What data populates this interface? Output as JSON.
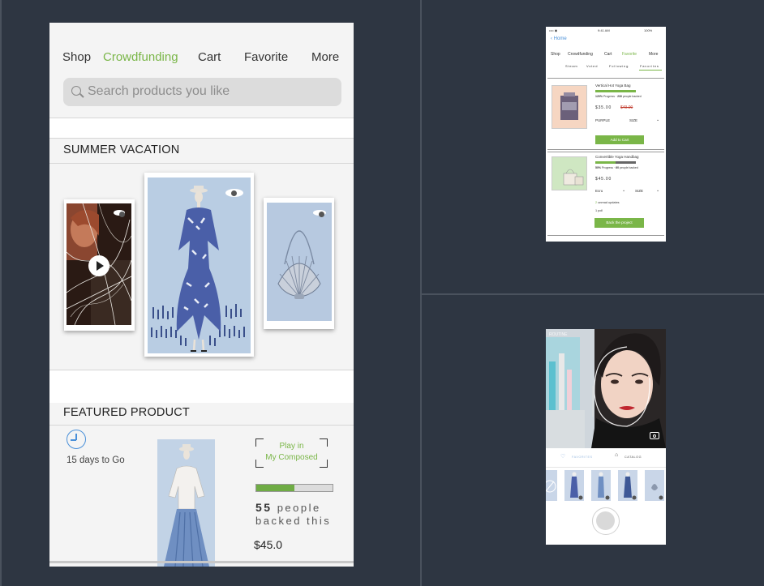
{
  "main": {
    "nav": [
      "Shop",
      "Crowdfunding",
      "Cart",
      "Favorite",
      "More"
    ],
    "active_nav": "Crowdfunding",
    "search_placeholder": "Search products you like",
    "summer_title": "SUMMER VACATION",
    "featured_title": "FEATURED PRODUCT",
    "days_left": "15 days to Go",
    "play_line1": "Play in",
    "play_line2": "My Composed",
    "progress": 0.5,
    "backed_count": "55",
    "backed_text1": "people",
    "backed_text2": "backed this",
    "price": "$45.0"
  },
  "mini1": {
    "status_left": "•••• ◉",
    "status_time": "9:41 AM",
    "status_right": "100%",
    "back": "Home",
    "nav": [
      "Shop",
      "Crowdfunding",
      "Cart",
      "Favorite",
      "More"
    ],
    "subnav": [
      "Steam",
      "Voted",
      "Following",
      "Favorites"
    ],
    "item1": {
      "name": "Vertical Hot Yoga Bag",
      "progress_pct": "120%",
      "progress_word": "Progress",
      "backers": "230",
      "backers_word": "people backed",
      "price": "$35.00",
      "old_price": "$49.00",
      "color": "PURPLE",
      "size": "SIZE",
      "button": "Add to Cart",
      "fill": 1.0
    },
    "item2": {
      "name": "Convertible Yoga Handbag",
      "progress_pct": "50%",
      "progress_word": "Progress",
      "backers": "60",
      "backers_word": "people backed",
      "price": "$45.00",
      "color": "Ecru",
      "size": "SIZE",
      "updates_count": "2",
      "updates_word": "unread updates",
      "poll": "1 poll",
      "button": "Back the project",
      "fill": 0.5
    }
  },
  "mini2": {
    "overlay": "ROUTINE",
    "tab1": "FAVORITES",
    "tab2": "CATALOG"
  },
  "colors": {
    "accent_green": "#7ab648",
    "bg": "#2e3642",
    "link_blue": "#4a90d9"
  }
}
